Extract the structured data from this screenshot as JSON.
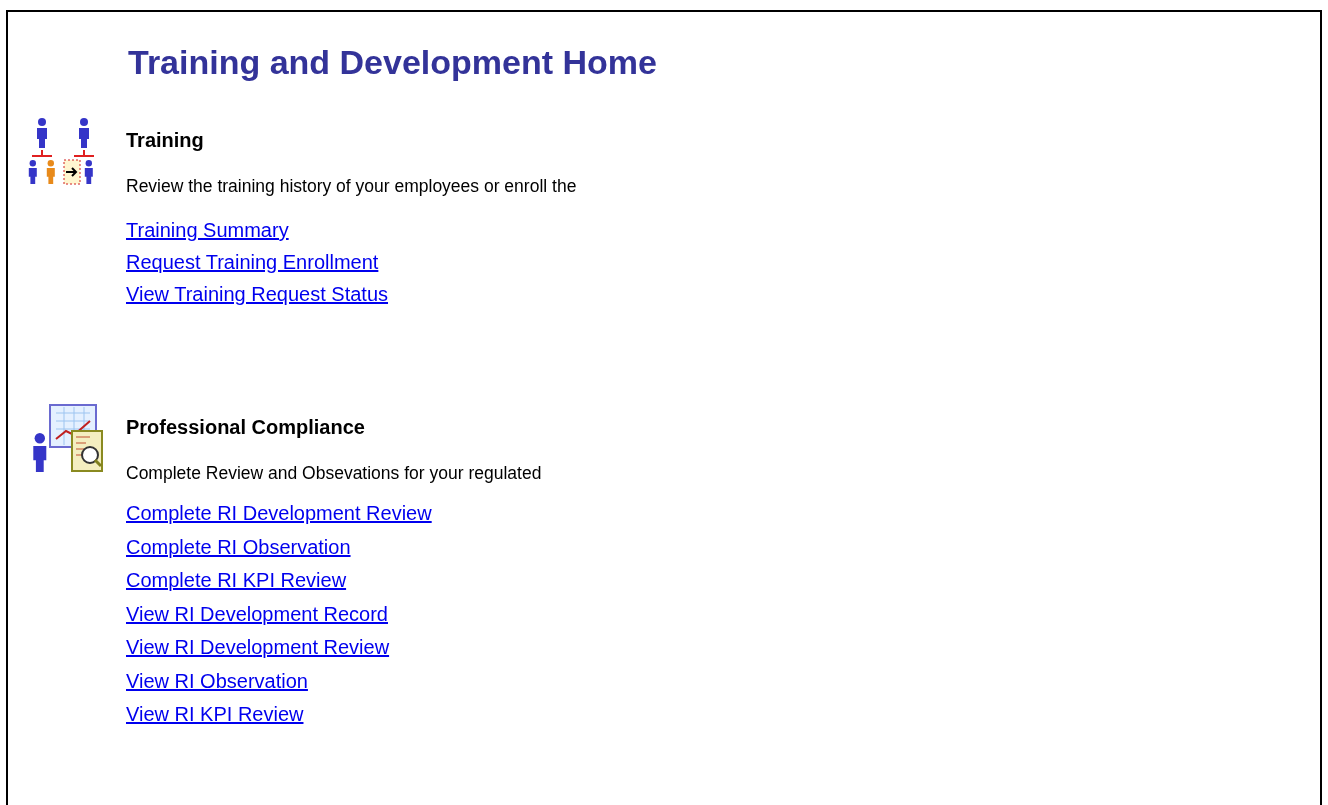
{
  "title": "Training and Development Home",
  "sections": [
    {
      "kind": "people",
      "heading": "Training",
      "description": "Review the training history of your employees or enroll the",
      "links": [
        "Training Summary",
        "Request Training Enrollment",
        "View Training Request Status"
      ]
    },
    {
      "kind": "report",
      "heading": "Professional Compliance",
      "description": "Complete Review and Obsevations for your regulated",
      "links": [
        "Complete RI Development Review",
        "Complete RI Observation",
        "Complete RI KPI Review",
        "View RI Development Record",
        "View RI Development Review",
        "View RI Observation",
        "View RI KPI Review"
      ]
    }
  ]
}
